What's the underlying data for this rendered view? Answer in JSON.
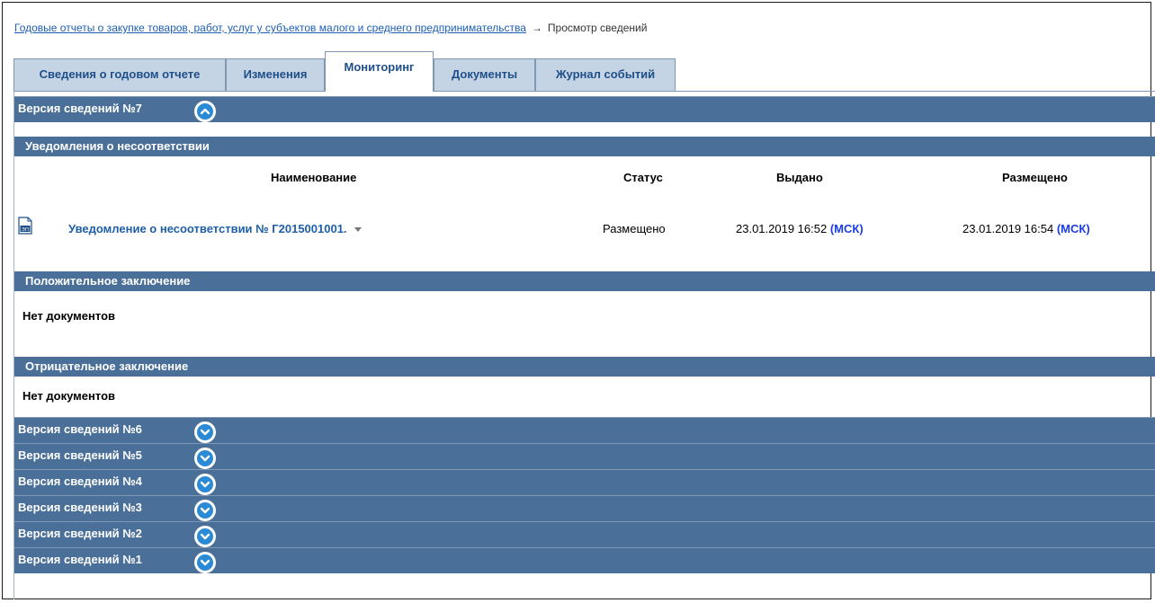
{
  "breadcrumb": {
    "parent": "Годовые отчеты о закупке товаров, работ, услуг у субъектов малого и среднего предпринимательства",
    "arrow": "→",
    "current": "Просмотр сведений"
  },
  "tabs": [
    {
      "label": "Сведения о годовом отчете",
      "active": false
    },
    {
      "label": "Изменения",
      "active": false
    },
    {
      "label": "Мониторинг",
      "active": true
    },
    {
      "label": "Документы",
      "active": false
    },
    {
      "label": "Журнал событий",
      "active": false
    }
  ],
  "expanded_version": {
    "label": "Версия сведений №7",
    "state": "expanded"
  },
  "sections": {
    "notices": {
      "title": "Уведомления о несоответствии",
      "columns": [
        "Наименование",
        "Статус",
        "Выдано",
        "Размещено"
      ],
      "rows": [
        {
          "icon": "document-signed-icon",
          "icon_text": "ЭП",
          "name": "Уведомление о несоответствии № Г2015001001.",
          "status": "Размещено",
          "issued": "23.01.2019 16:52",
          "issued_tz": "(МСК)",
          "placed": "23.01.2019 16:54",
          "placed_tz": "(МСК)"
        }
      ]
    },
    "positive": {
      "title": "Положительное заключение",
      "empty_text": "Нет документов"
    },
    "negative": {
      "title": "Отрицательное заключение",
      "empty_text": "Нет документов"
    }
  },
  "collapsed_versions": [
    {
      "label": "Версия сведений №6"
    },
    {
      "label": "Версия сведений №5"
    },
    {
      "label": "Версия сведений №4"
    },
    {
      "label": "Версия сведений №3"
    },
    {
      "label": "Версия сведений №2"
    },
    {
      "label": "Версия сведений №1"
    }
  ],
  "colors": {
    "header_bar": "#4a6f99",
    "tab_inactive": "#c5d4e4",
    "link": "#1f5fa8",
    "timezone": "#1a3de8",
    "toggle": "#2a8ad6"
  }
}
